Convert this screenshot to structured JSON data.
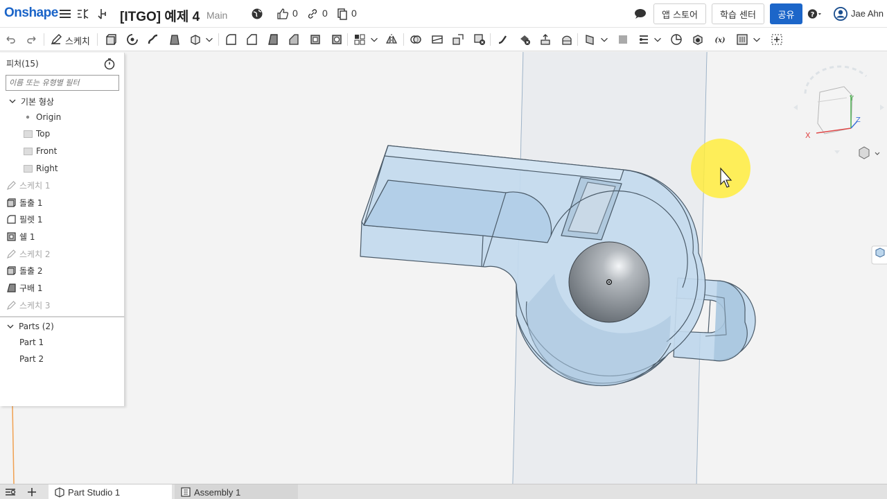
{
  "app": {
    "logo": "Onshape",
    "document_title": "[ITGO] 예제 4",
    "branch": "Main",
    "likes": "0",
    "links": "0",
    "copies": "0",
    "app_store_label": "앱 스토어",
    "learning_center_label": "학습 센터",
    "share_label": "공유",
    "user_name": "Jae Ahn"
  },
  "toolbar": {
    "sketch_label": "스케치"
  },
  "feature_panel": {
    "title": "피처(15)",
    "filter_placeholder": "이름 또는 유형별 필터",
    "default_geometry_label": "기본 형상",
    "default_items": [
      {
        "label": "Origin"
      },
      {
        "label": "Top"
      },
      {
        "label": "Front"
      },
      {
        "label": "Right"
      }
    ],
    "features": [
      {
        "label": "스케치 1",
        "icon": "sketch-icon",
        "suppressed": true
      },
      {
        "label": "돌출 1",
        "icon": "extrude-icon",
        "suppressed": false
      },
      {
        "label": "필렛 1",
        "icon": "fillet-icon",
        "suppressed": false
      },
      {
        "label": "쉘 1",
        "icon": "shell-icon",
        "suppressed": false
      },
      {
        "label": "스케치 2",
        "icon": "sketch-icon",
        "suppressed": true
      },
      {
        "label": "돌출 2",
        "icon": "extrude-icon",
        "suppressed": false
      },
      {
        "label": "구배 1",
        "icon": "draft-icon",
        "suppressed": false
      },
      {
        "label": "스케치 3",
        "icon": "sketch-icon",
        "suppressed": true
      }
    ],
    "parts_label": "Parts (2)",
    "parts": [
      {
        "label": "Part 1"
      },
      {
        "label": "Part 2"
      }
    ]
  },
  "view_cube": {
    "axis_x": "X",
    "axis_y": "Y",
    "axis_z": "Z"
  },
  "tabs": [
    {
      "label": "Part Studio 1",
      "active": true
    },
    {
      "label": "Assembly 1",
      "active": false
    }
  ],
  "colors": {
    "brand": "#1a64c8",
    "share_button": "#1c66c9",
    "part_fill": "#bcd6ec",
    "part_edge": "#4a5a68",
    "cursor_highlight": "#ffec3d"
  }
}
